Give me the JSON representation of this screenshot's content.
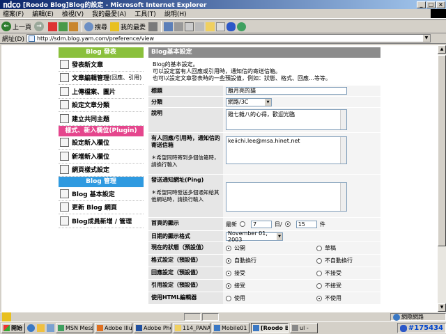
{
  "window": {
    "logo_text": "ndco",
    "title": "[Roodo Blog]Blog的設定 - Microsoft Internet Explorer",
    "controls": [
      "_",
      "□",
      "×"
    ]
  },
  "menu": [
    "檔案(F)",
    "編輯(E)",
    "檢視(V)",
    "我的最愛(A)",
    "工具(T)",
    "說明(H)"
  ],
  "toolbar": {
    "back": "上一頁",
    "search": "搜尋",
    "favorites": "我的最愛"
  },
  "address": {
    "label": "網址(D)",
    "url": "http://sdm.blog.yam.com/preference/view"
  },
  "nav": {
    "sections": [
      {
        "title": "Blog 發表",
        "color": "green",
        "items": [
          {
            "label": "發表新文章",
            "extra": ""
          },
          {
            "label": "文章編輯管理",
            "extra": "(回應、引用)"
          },
          {
            "label": "上傳檔案、圖片",
            "extra": ""
          },
          {
            "label": "設定文章分類",
            "extra": ""
          },
          {
            "label": "建立共同主題",
            "extra": ""
          }
        ]
      },
      {
        "title": "樣式、新入欄位(Plugin)",
        "color": "pink",
        "items": [
          {
            "label": "設定新入欄位",
            "extra": ""
          },
          {
            "label": "新增新入欄位",
            "extra": ""
          },
          {
            "label": "網頁樣式設定",
            "extra": ""
          }
        ]
      },
      {
        "title": "Blog 管理",
        "color": "blue",
        "items": [
          {
            "label": "Blog 基本設定",
            "extra": ""
          },
          {
            "label": "更新 Blog 網頁",
            "extra": ""
          },
          {
            "label": "Blog成員新增 / 管理",
            "extra": ""
          }
        ]
      }
    ]
  },
  "main": {
    "header": "Blog基本設定",
    "intro": [
      "Blog的基本設定。",
      "可以設定當有人回應或引用時，通知信的寄送信箱。",
      "也可以設定文章發表時的一些預設值，例如：狀態、格式、回應…等等。"
    ],
    "title_label": "標題",
    "title_value": "離月亮的貓",
    "category_label": "分類",
    "category_value": "網路/3C",
    "desc_label": "說明",
    "desc_value": "雞七雜八的心得，歡迎光臨",
    "notify_label": "有人回應/引用時，通知信的寄送信箱",
    "notify_note": "＊希望同時寄到多個信箱時，請換行輸入",
    "notify_value": "keiichi.lee@msa.hinet.net",
    "ping_label": "發送通知網址(Ping)",
    "ping_note": "＊希望同時發送多個通知給其他網站時，請換行輸入",
    "home_label": "首頁的顯示",
    "home_recent": "最新",
    "home_days_value": "7",
    "home_days_unit": "日/",
    "home_count_value": "15",
    "home_count_unit": "件",
    "date_label": "日期的顯示格式",
    "date_value": "November 01, 2003",
    "status_label": "現在的狀態（預設值）",
    "status_opt1": "公開",
    "status_opt2": "草稿",
    "format_label": "格式設定（預設值）",
    "format_opt1": "自動換行",
    "format_opt2": "不自動換行",
    "comment_label": "回應設定（預設值）",
    "comment_opt1": "接受",
    "comment_opt2": "不接受",
    "trackback_label": "引用設定（預設值）",
    "trackback_opt1": "接受",
    "trackback_opt2": "不接受",
    "html_label": "使用HTML編輯器",
    "html_opt1": "使用",
    "html_opt2": "不使用"
  },
  "status": {
    "zone": "網際網路"
  },
  "taskbar": {
    "start": "開始",
    "tasks": [
      "MSN Mess...",
      "Adobe Illu...",
      "Adobe Pho...",
      "114_PANA",
      "Mobile01 -...",
      "[Roodo Bl...",
      "ul -"
    ],
    "active_index": 5,
    "tray_text": "#175434"
  }
}
